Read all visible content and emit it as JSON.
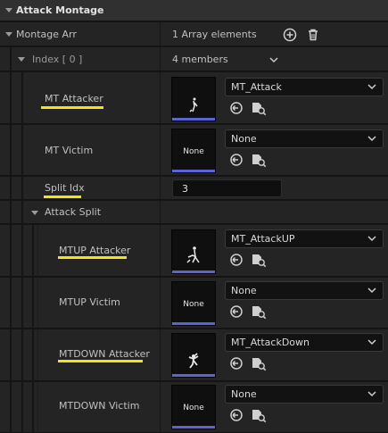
{
  "section_title": "Attack Montage",
  "montage_arr": {
    "label": "Montage Arr",
    "summary": "1 Array elements"
  },
  "index_row": {
    "label": "Index [ 0 ]",
    "summary": "4 members"
  },
  "fields": {
    "mt_attacker": {
      "label": "MT Attacker",
      "asset": "MT_Attack"
    },
    "mt_victim": {
      "label": "MT Victim",
      "asset": "None",
      "thumb": "None"
    },
    "split_idx": {
      "label": "Split Idx",
      "value": "3"
    },
    "attack_split": {
      "label": "Attack Split"
    },
    "mtup_attacker": {
      "label": "MTUP Attacker",
      "asset": "MT_AttackUP"
    },
    "mtup_victim": {
      "label": "MTUP Victim",
      "asset": "None",
      "thumb": "None"
    },
    "mtdown_attacker": {
      "label": "MTDOWN Attacker",
      "asset": "MT_AttackDown"
    },
    "mtdown_victim": {
      "label": "MTDOWN Victim",
      "asset": "None",
      "thumb": "None"
    }
  },
  "colors": {
    "highlight_underline": "#f3e60e",
    "thumb_strip": "#5865d6"
  },
  "icons": [
    "triangle-down-icon",
    "plus-circle-icon",
    "trash-icon",
    "chevron-down-icon",
    "reset-arrow-icon",
    "browse-folder-icon"
  ]
}
